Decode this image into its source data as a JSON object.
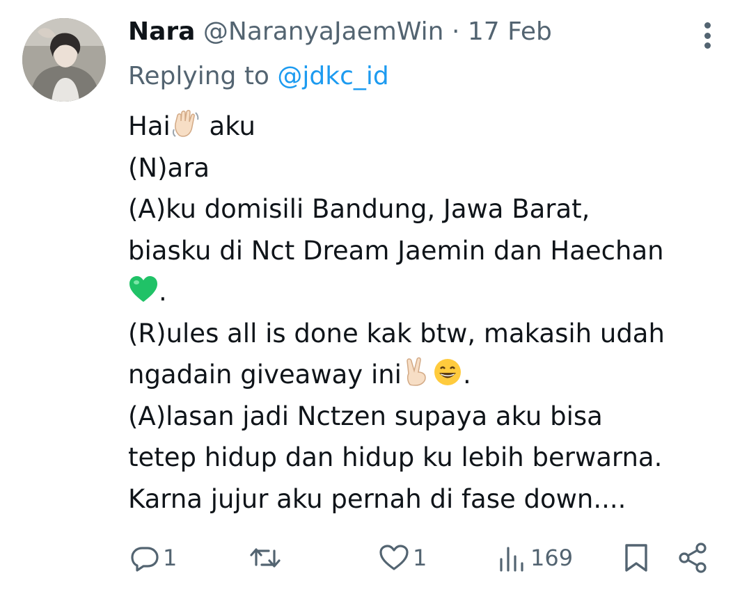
{
  "author": {
    "name": "Nara",
    "handle": "@NaranyaJaemWin",
    "separator": "·",
    "date": "17 Feb"
  },
  "replying": {
    "prefix": "Replying to",
    "mention": "@jdkc_id"
  },
  "body": {
    "line1_a": "Hai",
    "line1_b": " aku",
    "line2": "(N)ara",
    "line3": "(A)ku domisili Bandung, Jawa Barat,",
    "line4": "biasku di Nct Dream Jaemin dan Haechan",
    "line5": ".",
    "line6": "(R)ules all is done kak btw, makasih udah",
    "line7_a": "ngadain giveaway ini",
    "line7_b": ".",
    "line8": "(A)lasan jadi Nctzen supaya aku bisa",
    "line9": "tetep hidup dan hidup ku lebih berwarna.",
    "line10": "Karna jujur aku pernah di fase down...."
  },
  "emojis": [
    "waving-hand",
    "green-heart",
    "victory-hand",
    "grinning-face"
  ],
  "actions": {
    "replies": "1",
    "likes": "1",
    "views": "169"
  },
  "colors": {
    "text": "#0f1419",
    "secondary": "#536471",
    "link": "#1d9bf0",
    "background": "#ffffff"
  }
}
